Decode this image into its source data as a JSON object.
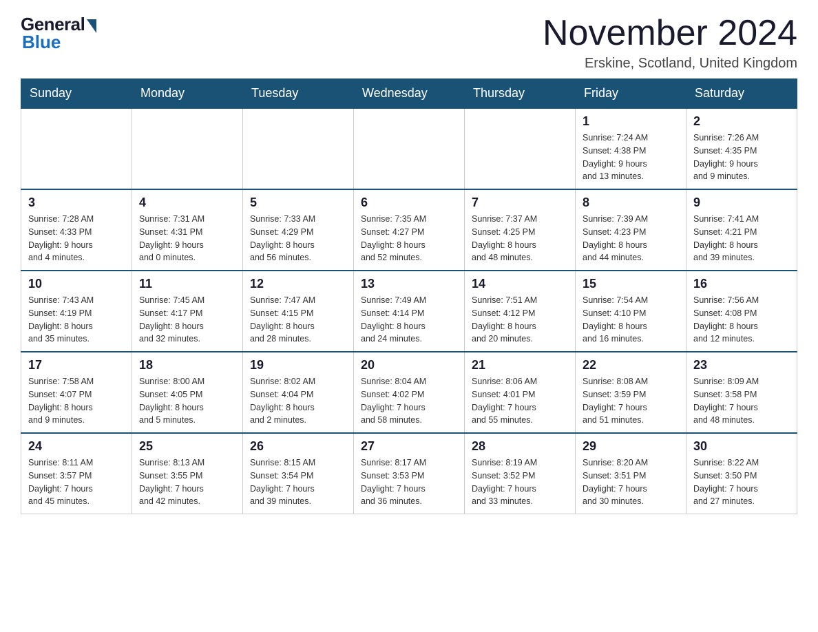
{
  "logo": {
    "general": "General",
    "blue": "Blue"
  },
  "title": "November 2024",
  "location": "Erskine, Scotland, United Kingdom",
  "days_header": [
    "Sunday",
    "Monday",
    "Tuesday",
    "Wednesday",
    "Thursday",
    "Friday",
    "Saturday"
  ],
  "weeks": [
    [
      {
        "day": "",
        "info": ""
      },
      {
        "day": "",
        "info": ""
      },
      {
        "day": "",
        "info": ""
      },
      {
        "day": "",
        "info": ""
      },
      {
        "day": "",
        "info": ""
      },
      {
        "day": "1",
        "info": "Sunrise: 7:24 AM\nSunset: 4:38 PM\nDaylight: 9 hours\nand 13 minutes."
      },
      {
        "day": "2",
        "info": "Sunrise: 7:26 AM\nSunset: 4:35 PM\nDaylight: 9 hours\nand 9 minutes."
      }
    ],
    [
      {
        "day": "3",
        "info": "Sunrise: 7:28 AM\nSunset: 4:33 PM\nDaylight: 9 hours\nand 4 minutes."
      },
      {
        "day": "4",
        "info": "Sunrise: 7:31 AM\nSunset: 4:31 PM\nDaylight: 9 hours\nand 0 minutes."
      },
      {
        "day": "5",
        "info": "Sunrise: 7:33 AM\nSunset: 4:29 PM\nDaylight: 8 hours\nand 56 minutes."
      },
      {
        "day": "6",
        "info": "Sunrise: 7:35 AM\nSunset: 4:27 PM\nDaylight: 8 hours\nand 52 minutes."
      },
      {
        "day": "7",
        "info": "Sunrise: 7:37 AM\nSunset: 4:25 PM\nDaylight: 8 hours\nand 48 minutes."
      },
      {
        "day": "8",
        "info": "Sunrise: 7:39 AM\nSunset: 4:23 PM\nDaylight: 8 hours\nand 44 minutes."
      },
      {
        "day": "9",
        "info": "Sunrise: 7:41 AM\nSunset: 4:21 PM\nDaylight: 8 hours\nand 39 minutes."
      }
    ],
    [
      {
        "day": "10",
        "info": "Sunrise: 7:43 AM\nSunset: 4:19 PM\nDaylight: 8 hours\nand 35 minutes."
      },
      {
        "day": "11",
        "info": "Sunrise: 7:45 AM\nSunset: 4:17 PM\nDaylight: 8 hours\nand 32 minutes."
      },
      {
        "day": "12",
        "info": "Sunrise: 7:47 AM\nSunset: 4:15 PM\nDaylight: 8 hours\nand 28 minutes."
      },
      {
        "day": "13",
        "info": "Sunrise: 7:49 AM\nSunset: 4:14 PM\nDaylight: 8 hours\nand 24 minutes."
      },
      {
        "day": "14",
        "info": "Sunrise: 7:51 AM\nSunset: 4:12 PM\nDaylight: 8 hours\nand 20 minutes."
      },
      {
        "day": "15",
        "info": "Sunrise: 7:54 AM\nSunset: 4:10 PM\nDaylight: 8 hours\nand 16 minutes."
      },
      {
        "day": "16",
        "info": "Sunrise: 7:56 AM\nSunset: 4:08 PM\nDaylight: 8 hours\nand 12 minutes."
      }
    ],
    [
      {
        "day": "17",
        "info": "Sunrise: 7:58 AM\nSunset: 4:07 PM\nDaylight: 8 hours\nand 9 minutes."
      },
      {
        "day": "18",
        "info": "Sunrise: 8:00 AM\nSunset: 4:05 PM\nDaylight: 8 hours\nand 5 minutes."
      },
      {
        "day": "19",
        "info": "Sunrise: 8:02 AM\nSunset: 4:04 PM\nDaylight: 8 hours\nand 2 minutes."
      },
      {
        "day": "20",
        "info": "Sunrise: 8:04 AM\nSunset: 4:02 PM\nDaylight: 7 hours\nand 58 minutes."
      },
      {
        "day": "21",
        "info": "Sunrise: 8:06 AM\nSunset: 4:01 PM\nDaylight: 7 hours\nand 55 minutes."
      },
      {
        "day": "22",
        "info": "Sunrise: 8:08 AM\nSunset: 3:59 PM\nDaylight: 7 hours\nand 51 minutes."
      },
      {
        "day": "23",
        "info": "Sunrise: 8:09 AM\nSunset: 3:58 PM\nDaylight: 7 hours\nand 48 minutes."
      }
    ],
    [
      {
        "day": "24",
        "info": "Sunrise: 8:11 AM\nSunset: 3:57 PM\nDaylight: 7 hours\nand 45 minutes."
      },
      {
        "day": "25",
        "info": "Sunrise: 8:13 AM\nSunset: 3:55 PM\nDaylight: 7 hours\nand 42 minutes."
      },
      {
        "day": "26",
        "info": "Sunrise: 8:15 AM\nSunset: 3:54 PM\nDaylight: 7 hours\nand 39 minutes."
      },
      {
        "day": "27",
        "info": "Sunrise: 8:17 AM\nSunset: 3:53 PM\nDaylight: 7 hours\nand 36 minutes."
      },
      {
        "day": "28",
        "info": "Sunrise: 8:19 AM\nSunset: 3:52 PM\nDaylight: 7 hours\nand 33 minutes."
      },
      {
        "day": "29",
        "info": "Sunrise: 8:20 AM\nSunset: 3:51 PM\nDaylight: 7 hours\nand 30 minutes."
      },
      {
        "day": "30",
        "info": "Sunrise: 8:22 AM\nSunset: 3:50 PM\nDaylight: 7 hours\nand 27 minutes."
      }
    ]
  ]
}
